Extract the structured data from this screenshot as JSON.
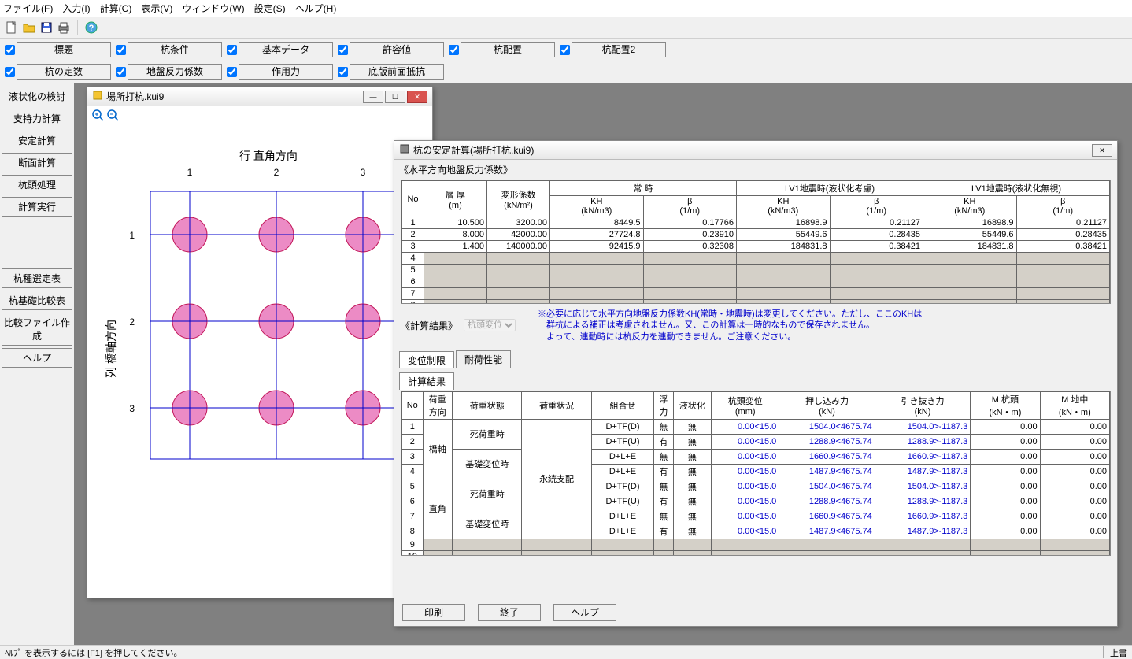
{
  "menu": {
    "file": "ファイル(F)",
    "input": "入力(I)",
    "calc": "計算(C)",
    "view": "表示(V)",
    "window": "ウィンドウ(W)",
    "settings": "設定(S)",
    "help": "ヘルプ(H)"
  },
  "checkrow1": {
    "title": "標題",
    "pile_cond": "杭条件",
    "basic_data": "基本データ",
    "allowable": "許容値",
    "pile_layout": "杭配置",
    "pile_layout2": "杭配置2"
  },
  "checkrow2": {
    "pile_const": "杭の定数",
    "ground_coef": "地盤反力係数",
    "force": "作用力",
    "bottom_resist": "底版前面抵抗"
  },
  "side": {
    "liq": "液状化の検討",
    "bear": "支持力計算",
    "stab": "安定計算",
    "sect": "断面計算",
    "head": "杭頭処理",
    "exec": "計算実行",
    "type": "杭種選定表",
    "comp": "杭基礎比較表",
    "cmpfile": "比較ファイル作成",
    "help": "ヘルプ"
  },
  "pilewin": {
    "title": "場所打杭.kui9",
    "col_label": "行  直角方向",
    "row_label": "列  橋軸方向"
  },
  "anzwin": {
    "title": "杭の安定計算(場所打杭.kui9)",
    "sec1": "《水平方向地盤反力係数》",
    "th": {
      "no": "No",
      "thick": "層 厚\n(m)",
      "deform": "変形係数\n(kN/m²)",
      "jyoji": "常  時",
      "lv1liq": "LV1地震時(液状化考慮)",
      "lv1noliq": "LV1地震時(液状化無視)",
      "kh": "KH\n(kN/m3)",
      "beta": "β\n(1/m)"
    },
    "rows": [
      {
        "no": "1",
        "thick": "10.500",
        "deform": "3200.00",
        "kh1": "8449.5",
        "b1": "0.17766",
        "kh2": "16898.9",
        "b2": "0.21127",
        "kh3": "16898.9",
        "b3": "0.21127"
      },
      {
        "no": "2",
        "thick": "8.000",
        "deform": "42000.00",
        "kh1": "27724.8",
        "b1": "0.23910",
        "kh2": "55449.6",
        "b2": "0.28435",
        "kh3": "55449.6",
        "b3": "0.28435"
      },
      {
        "no": "3",
        "thick": "1.400",
        "deform": "140000.00",
        "kh1": "92415.9",
        "b1": "0.32308",
        "kh2": "184831.8",
        "b2": "0.38421",
        "kh3": "184831.8",
        "b3": "0.38421"
      }
    ],
    "sec2": "《計算結果》",
    "dropdown": "杭頭変位",
    "note1": "※必要に応じて水平方向地盤反力係数KH(常時・地震時)は変更してください。ただし、ここのKHは",
    "note2": "　群杭による補正は考慮されません。又、この計算は一時的なもので保存されません。",
    "note3": "　よって、連動時には杭反力を連動できません。ご注意ください。",
    "tabs": {
      "disp": "変位制限",
      "perf": "耐荷性能"
    },
    "subtab": "計算結果",
    "rth": {
      "no": "No",
      "dir": "荷重\n方向",
      "state": "荷重状態",
      "cond": "荷重状況",
      "comb": "組合せ",
      "buoy": "浮\n力",
      "liq": "液状化",
      "headdisp": "杭頭変位\n(mm)",
      "push": "押し込み力\n(kN)",
      "pull": "引き抜き力\n(kN)",
      "mhead": "M 杭頭\n(kN・m)",
      "mmid": "M 地中\n(kN・m)"
    },
    "dir": {
      "axis": "橋軸",
      "perp": "直角"
    },
    "state": {
      "dead": "死荷重時",
      "found": "基礎変位時"
    },
    "cond": "永続支配",
    "yes": "有",
    "no": "無",
    "rrows": [
      {
        "no": "1",
        "comb": "D+TF(D)",
        "buoy": "無",
        "liq": "無",
        "d": "0.00<15.0",
        "p": "1504.0<4675.74",
        "pu": "1504.0>-1187.3",
        "mh": "0.00",
        "mm": "0.00"
      },
      {
        "no": "2",
        "comb": "D+TF(U)",
        "buoy": "有",
        "liq": "無",
        "d": "0.00<15.0",
        "p": "1288.9<4675.74",
        "pu": "1288.9>-1187.3",
        "mh": "0.00",
        "mm": "0.00"
      },
      {
        "no": "3",
        "comb": "D+L+E",
        "buoy": "無",
        "liq": "無",
        "d": "0.00<15.0",
        "p": "1660.9<4675.74",
        "pu": "1660.9>-1187.3",
        "mh": "0.00",
        "mm": "0.00"
      },
      {
        "no": "4",
        "comb": "D+L+E",
        "buoy": "有",
        "liq": "無",
        "d": "0.00<15.0",
        "p": "1487.9<4675.74",
        "pu": "1487.9>-1187.3",
        "mh": "0.00",
        "mm": "0.00"
      },
      {
        "no": "5",
        "comb": "D+TF(D)",
        "buoy": "無",
        "liq": "無",
        "d": "0.00<15.0",
        "p": "1504.0<4675.74",
        "pu": "1504.0>-1187.3",
        "mh": "0.00",
        "mm": "0.00"
      },
      {
        "no": "6",
        "comb": "D+TF(U)",
        "buoy": "有",
        "liq": "無",
        "d": "0.00<15.0",
        "p": "1288.9<4675.74",
        "pu": "1288.9>-1187.3",
        "mh": "0.00",
        "mm": "0.00"
      },
      {
        "no": "7",
        "comb": "D+L+E",
        "buoy": "無",
        "liq": "無",
        "d": "0.00<15.0",
        "p": "1660.9<4675.74",
        "pu": "1660.9>-1187.3",
        "mh": "0.00",
        "mm": "0.00"
      },
      {
        "no": "8",
        "comb": "D+L+E",
        "buoy": "有",
        "liq": "無",
        "d": "0.00<15.0",
        "p": "1487.9<4675.74",
        "pu": "1487.9>-1187.3",
        "mh": "0.00",
        "mm": "0.00"
      }
    ],
    "btn": {
      "print": "印刷",
      "close": "終了",
      "help": "ヘルプ"
    }
  },
  "status": {
    "left": "ﾍﾙﾌﾟ を表示するには [F1] を押してください。",
    "right": "上書"
  }
}
